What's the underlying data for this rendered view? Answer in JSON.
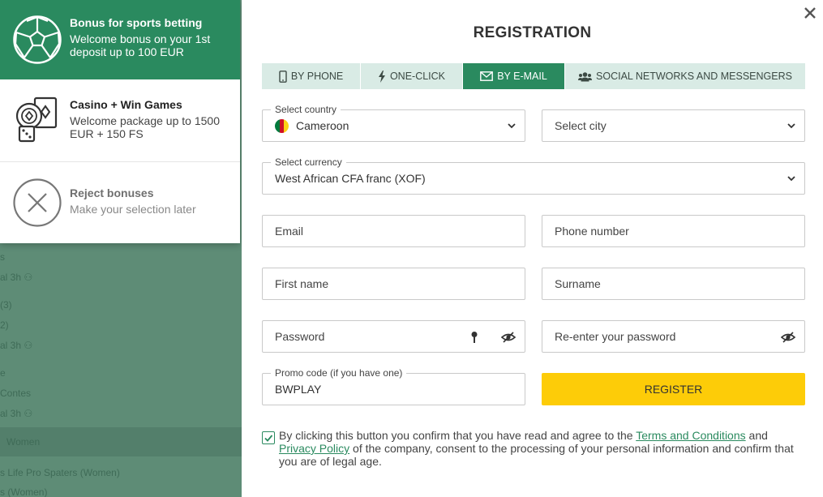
{
  "background": {
    "rows": [
      "s",
      "al  3h  ⚇",
      "(3)",
      "2)",
      "al  3h  ⚇",
      "e",
      "Contes",
      "al  3h  ⚇",
      "Women",
      "s Life Pro Spaters (Women)",
      "s (Women)"
    ]
  },
  "bonuses": {
    "sport": {
      "title": "Bonus for sports betting",
      "desc": "Welcome bonus on your 1st deposit up to 100 EUR"
    },
    "casino": {
      "title": "Casino + Win Games",
      "desc": "Welcome package up to 1500 EUR + 150 FS"
    },
    "reject": {
      "title": "Reject bonuses",
      "desc": "Make your selection later"
    }
  },
  "modal": {
    "title": "REGISTRATION",
    "tabs": [
      {
        "label": "BY PHONE",
        "icon": "phone-icon"
      },
      {
        "label": "ONE-CLICK",
        "icon": "lightning-icon"
      },
      {
        "label": "BY E-MAIL",
        "icon": "envelope-icon",
        "active": true
      },
      {
        "label": "SOCIAL NETWORKS AND MESSENGERS",
        "icon": "users-icon"
      }
    ],
    "country": {
      "label": "Select country",
      "value": "Cameroon"
    },
    "city": {
      "placeholder": "Select city"
    },
    "currency": {
      "label": "Select currency",
      "value": "West African CFA franc (XOF)"
    },
    "email": {
      "placeholder": "Email"
    },
    "phone": {
      "placeholder": "Phone number"
    },
    "first_name": {
      "placeholder": "First name"
    },
    "surname": {
      "placeholder": "Surname"
    },
    "password": {
      "placeholder": "Password"
    },
    "repassword": {
      "placeholder": "Re-enter your password"
    },
    "promo": {
      "label": "Promo code (if you have one)",
      "value": "BWPLAY"
    },
    "register_label": "REGISTER",
    "agree": {
      "before": "By clicking this button you confirm that you have read and agree to the ",
      "terms": "Terms and Conditions",
      "and": " and ",
      "privacy": "Privacy Policy",
      "after": " of the company, consent to the processing of your personal information and confirm that you are of legal age."
    }
  },
  "colors": {
    "brand_green": "#2a8a5f",
    "register_yellow": "#fdcc08",
    "tab_bg": "#d9ebe5"
  }
}
